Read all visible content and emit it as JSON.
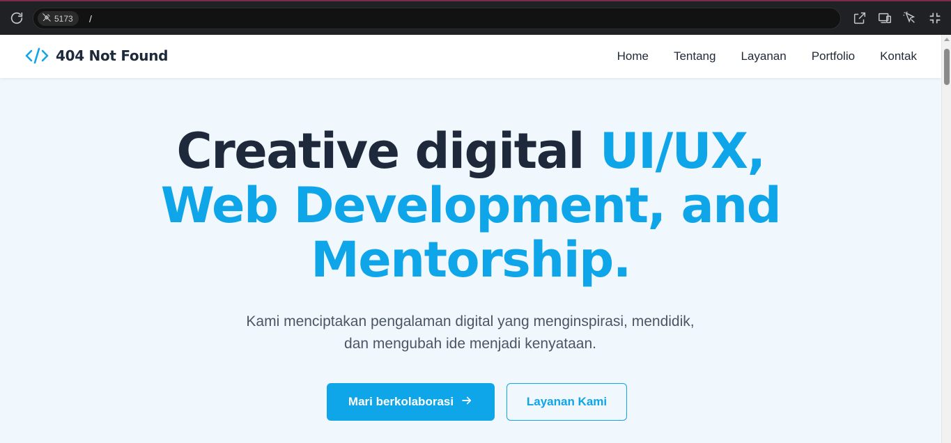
{
  "browser": {
    "port": "5173",
    "path": "/"
  },
  "navbar": {
    "brand": "404 Not Found",
    "links": [
      "Home",
      "Tentang",
      "Layanan",
      "Portfolio",
      "Kontak"
    ]
  },
  "hero": {
    "headline_dark": "Creative digital ",
    "headline_blue_1": "UI/UX,",
    "headline_blue_2": "Web Development, and",
    "headline_blue_3": "Mentorship.",
    "subtitle_line1": "Kami menciptakan pengalaman digital yang menginspirasi, mendidik,",
    "subtitle_line2": "dan mengubah ide menjadi kenyataan.",
    "primary_button": "Mari berkolaborasi",
    "secondary_button": "Layanan Kami"
  },
  "colors": {
    "accent": "#0ea5e9",
    "heading_dark": "#1e293b",
    "hero_bg": "#f0f7fd"
  }
}
